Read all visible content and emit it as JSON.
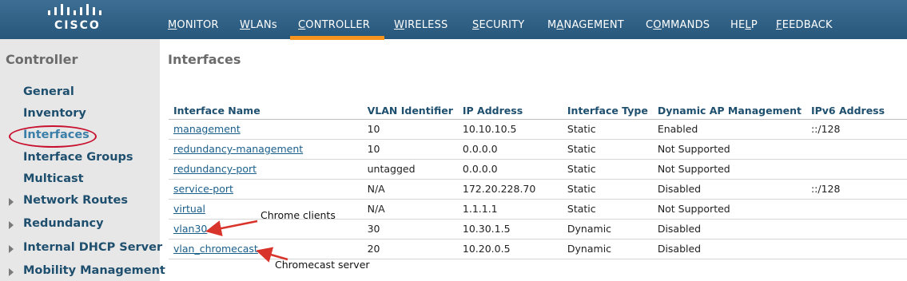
{
  "header": {
    "logo_text": "CISCO",
    "nav": [
      {
        "label": "MONITOR",
        "ul": "M",
        "rest": "ONITOR"
      },
      {
        "label": "WLANs",
        "ul": "W",
        "rest": "LANs"
      },
      {
        "label": "CONTROLLER",
        "ul": "C",
        "rest": "ONTROLLER"
      },
      {
        "label": "WIRELESS",
        "ul": "W",
        "rest": "IRELESS"
      },
      {
        "label": "SECURITY",
        "ul": "S",
        "rest": "ECURITY"
      },
      {
        "label": "MANAGEMENT",
        "pre": "M",
        "ul": "A",
        "rest": "NAGEMENT"
      },
      {
        "label": "COMMANDS",
        "pre": "C",
        "ul": "O",
        "rest": "MMANDS"
      },
      {
        "label": "HELP",
        "pre": "HE",
        "ul": "L",
        "rest": "P"
      },
      {
        "label": "FEEDBACK",
        "ul": "F",
        "rest": "EEDBACK"
      }
    ],
    "active_color": "#f7941e"
  },
  "sidebar": {
    "title": "Controller",
    "items": [
      {
        "label": "General"
      },
      {
        "label": "Inventory"
      },
      {
        "label": "Interfaces"
      },
      {
        "label": "Interface Groups"
      },
      {
        "label": "Multicast"
      },
      {
        "label": "Network Routes"
      },
      {
        "label": "Redundancy"
      },
      {
        "label": "Internal DHCP Server"
      },
      {
        "label": "Mobility Management"
      }
    ]
  },
  "main": {
    "title": "Interfaces",
    "columns": [
      "Interface Name",
      "VLAN Identifier",
      "IP Address",
      "Interface Type",
      "Dynamic AP Management",
      "IPv6 Address"
    ],
    "rows": [
      [
        "management",
        "10",
        "10.10.10.5",
        "Static",
        "Enabled",
        "::/128"
      ],
      [
        "redundancy-management",
        "10",
        "0.0.0.0",
        "Static",
        "Not Supported",
        ""
      ],
      [
        "redundancy-port",
        "untagged",
        "0.0.0.0",
        "Static",
        "Not Supported",
        ""
      ],
      [
        "service-port",
        "N/A",
        "172.20.228.70",
        "Static",
        "Disabled",
        "::/128"
      ],
      [
        "virtual",
        "N/A",
        "1.1.1.1",
        "Static",
        "Not Supported",
        ""
      ],
      [
        "vlan30",
        "30",
        "10.30.1.5",
        "Dynamic",
        "Disabled",
        ""
      ],
      [
        "vlan_chromecast",
        "20",
        "10.20.0.5",
        "Dynamic",
        "Disabled",
        ""
      ]
    ]
  },
  "annotations": {
    "chrome_clients": "Chrome clients",
    "chromecast_server": "Chromecast server",
    "color": "#d9342b"
  }
}
